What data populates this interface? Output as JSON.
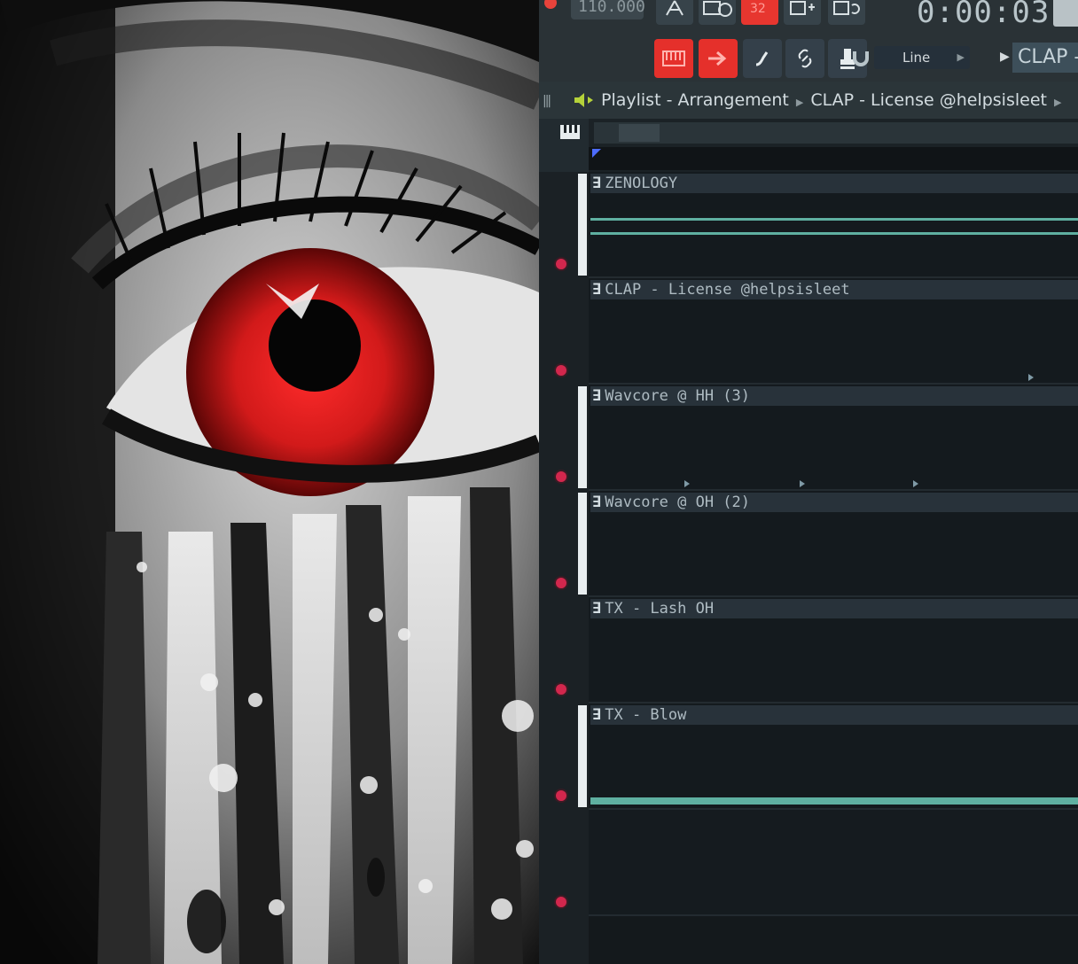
{
  "toolbar": {
    "tempo": "110.000",
    "song_time": "0:00:03",
    "snap_label": "Line",
    "pattern_name": "CLAP -..."
  },
  "playlist": {
    "breadcrumb": [
      "Playlist",
      "Arrangement",
      "CLAP",
      "License @helpsisleet"
    ],
    "crumb_1": "Playlist - Arrangement",
    "crumb_2": "CLAP - License @helpsisleet"
  },
  "tracks": [
    {
      "label": "ZENOLOGY"
    },
    {
      "label": "CLAP - License @helpsisleet"
    },
    {
      "label": "Wavcore @ HH (3)"
    },
    {
      "label": "Wavcore @ OH (2)"
    },
    {
      "label": "TX - Lash OH"
    },
    {
      "label": "TX - Blow"
    }
  ],
  "colors": {
    "accent_red": "#e7362f",
    "teal": "#5fb0a1",
    "eye_red": "#d21a1a",
    "marker_blue": "#4d6cff"
  },
  "icons": [
    "record-dot-icon",
    "metronome-icon",
    "piano-roll-icon",
    "channel-rack-icon",
    "speaker-icon",
    "magnet-icon",
    "link-icon",
    "stamp-icon",
    "paint-icon",
    "arrow-icon"
  ]
}
